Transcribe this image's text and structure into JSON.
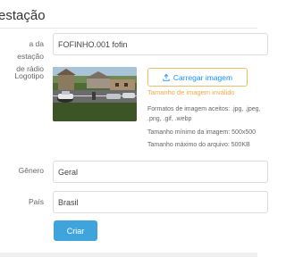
{
  "page": {
    "title": "estação"
  },
  "form": {
    "name_label_line1": "a da estação",
    "name_label_line2": "de rádio",
    "name_value": "FOFINHO.001 fofin",
    "logo_label": "Logotipo",
    "upload_label": "Carregar imagem",
    "upload_icon": "upload-icon",
    "error_text": "Tamanho de imagem inválido",
    "formats_line1": "Formatos de imagem aceitos: .jpg, .jpeg,",
    "formats_line2": ".png, .gif, .webp",
    "min_size": "Tamanho mínimo da imagem: 500x500",
    "max_size": "Tamanho máximo do arquivo: 500KB",
    "genre_label": "Gênero",
    "genre_value": "Geral",
    "country_label": "País",
    "country_value": "Brasil",
    "submit_label": "Criar"
  },
  "colors": {
    "primary": "#3fa3dc",
    "upload_border": "#e6c16a",
    "error": "#f0a94a",
    "link": "#1890ff"
  }
}
